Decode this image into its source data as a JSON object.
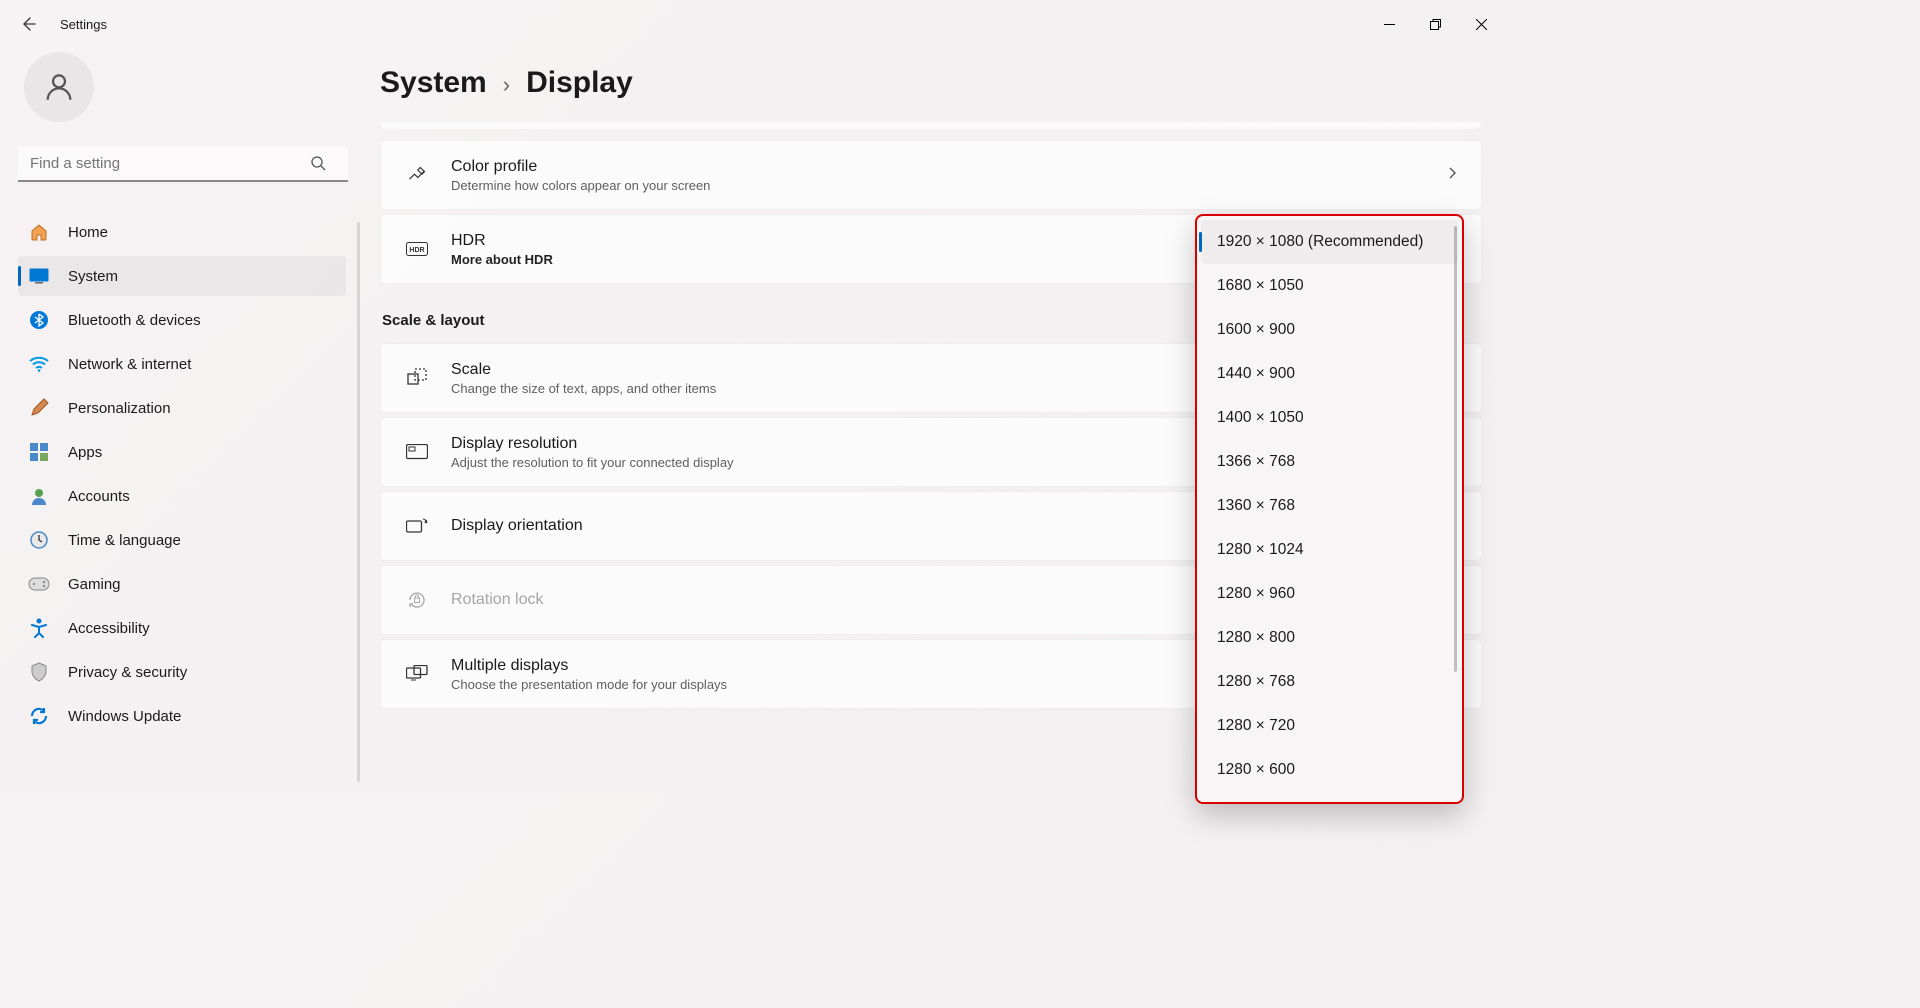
{
  "titlebar": {
    "app_name": "Settings"
  },
  "sidebar": {
    "search_placeholder": "Find a setting",
    "items": [
      {
        "label": "Home",
        "icon": "home"
      },
      {
        "label": "System",
        "icon": "system",
        "active": true
      },
      {
        "label": "Bluetooth & devices",
        "icon": "bluetooth"
      },
      {
        "label": "Network & internet",
        "icon": "wifi"
      },
      {
        "label": "Personalization",
        "icon": "brush"
      },
      {
        "label": "Apps",
        "icon": "apps"
      },
      {
        "label": "Accounts",
        "icon": "account"
      },
      {
        "label": "Time & language",
        "icon": "time"
      },
      {
        "label": "Gaming",
        "icon": "gaming"
      },
      {
        "label": "Accessibility",
        "icon": "accessibility"
      },
      {
        "label": "Privacy & security",
        "icon": "privacy"
      },
      {
        "label": "Windows Update",
        "icon": "update"
      }
    ]
  },
  "breadcrumb": {
    "parent": "System",
    "current": "Display"
  },
  "cards": {
    "color_profile": {
      "title": "Color profile",
      "sub": "Determine how colors appear on your screen"
    },
    "hdr": {
      "title": "HDR",
      "sub": "More about HDR"
    },
    "section_scale": "Scale & layout",
    "scale": {
      "title": "Scale",
      "sub": "Change the size of text, apps, and other items"
    },
    "resolution": {
      "title": "Display resolution",
      "sub": "Adjust the resolution to fit your connected display"
    },
    "orientation": {
      "title": "Display orientation"
    },
    "rotation": {
      "title": "Rotation lock"
    },
    "multi": {
      "title": "Multiple displays",
      "sub": "Choose the presentation mode for your displays"
    }
  },
  "resolution_dropdown": {
    "selected_index": 0,
    "options": [
      "1920 × 1080 (Recommended)",
      "1680 × 1050",
      "1600 × 900",
      "1440 × 900",
      "1400 × 1050",
      "1366 × 768",
      "1360 × 768",
      "1280 × 1024",
      "1280 × 960",
      "1280 × 800",
      "1280 × 768",
      "1280 × 720",
      "1280 × 600"
    ]
  }
}
